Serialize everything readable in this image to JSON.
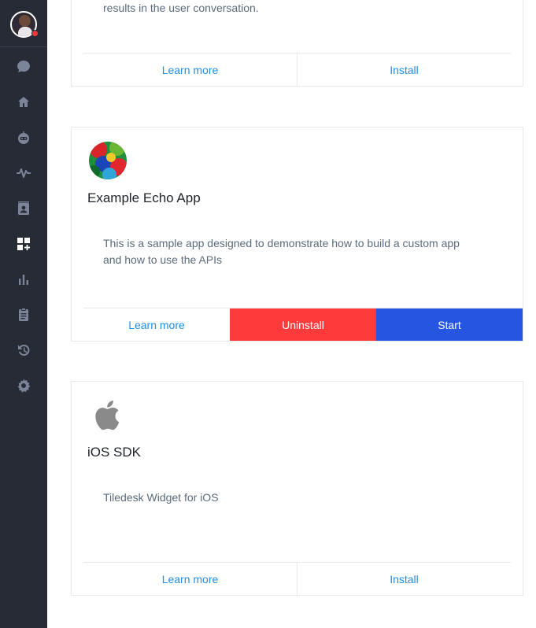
{
  "sidebar": {
    "user": {
      "status_color": "#f4393b"
    },
    "items": [
      {
        "icon": "chat-bubble-icon"
      },
      {
        "icon": "home-icon"
      },
      {
        "icon": "bot-icon"
      },
      {
        "icon": "activity-icon"
      },
      {
        "icon": "contacts-icon"
      },
      {
        "icon": "apps-icon",
        "active": true
      },
      {
        "icon": "analytics-icon"
      },
      {
        "icon": "clipboard-icon"
      },
      {
        "icon": "history-icon"
      },
      {
        "icon": "settings-icon"
      }
    ]
  },
  "cards": [
    {
      "description": "results in the user conversation.",
      "learn_more": "Learn more",
      "install": "Install"
    },
    {
      "title": "Example Echo App",
      "description": "This is a sample app designed to demonstrate how to build a custom app and how to use the APIs",
      "learn_more": "Learn more",
      "uninstall": "Uninstall",
      "start": "Start"
    },
    {
      "title": "iOS SDK",
      "description": "Tiledesk Widget for iOS",
      "learn_more": "Learn more",
      "install": "Install"
    }
  ],
  "colors": {
    "sidebar_bg": "#262b36",
    "link_blue": "#1f8ee6",
    "uninstall_red": "#ff3a3a",
    "start_blue": "#2655e2"
  }
}
